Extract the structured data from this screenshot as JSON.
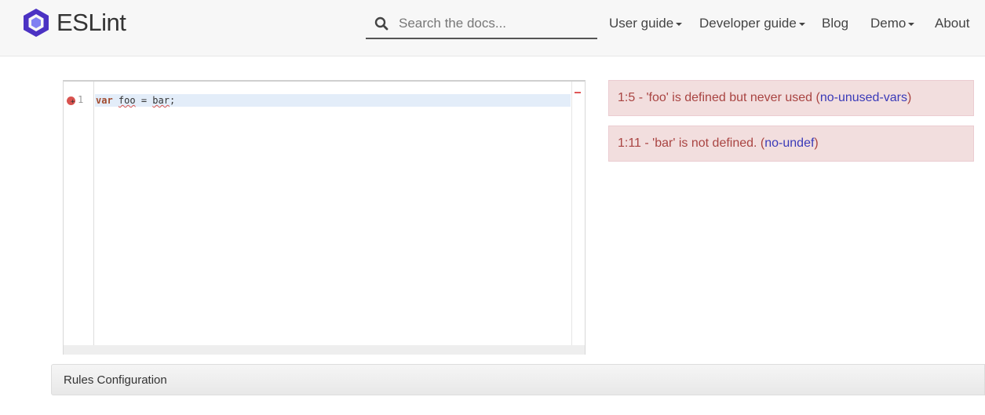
{
  "header": {
    "brand_name": "ESLint",
    "brand_color": "#4B32C3",
    "search": {
      "placeholder": "Search the docs...",
      "value": "",
      "icon": "search-icon"
    },
    "nav": [
      {
        "label": "User guide",
        "dropdown": true
      },
      {
        "label": "Developer guide",
        "dropdown": true
      },
      {
        "label": "Blog",
        "dropdown": false
      },
      {
        "label": "Demo",
        "dropdown": true
      },
      {
        "label": "About",
        "dropdown": false
      }
    ]
  },
  "editor": {
    "line_number": "1",
    "code": {
      "keyword": "var",
      "ident": "foo",
      "op": " = ",
      "value": "bar",
      "end": ";"
    }
  },
  "messages": [
    {
      "text": "1:5 - 'foo' is defined but never used (",
      "rule": "no-unused-vars",
      "close": ")"
    },
    {
      "text": "1:11 - 'bar' is not defined. (",
      "rule": "no-undef",
      "close": ")"
    }
  ],
  "rules_config": {
    "label": "Rules Configuration"
  },
  "colors": {
    "error_bg": "#f2dede",
    "error_text": "#a94442",
    "link": "#3a3ab8"
  }
}
